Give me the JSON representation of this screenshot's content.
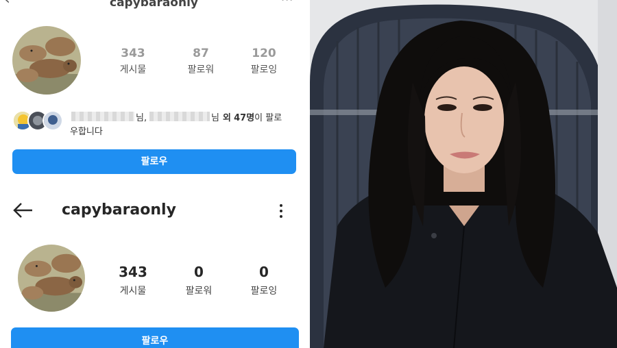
{
  "screenshot_top": {
    "username": "capybaraonly",
    "stats": [
      {
        "value": "343",
        "label": "게시물"
      },
      {
        "value": "87",
        "label": "팔로워"
      },
      {
        "value": "120",
        "label": "팔로잉"
      }
    ],
    "followed_by": {
      "suffix_1": "님,",
      "suffix_2": "님",
      "others_prefix": "외",
      "others_count": "47명",
      "tail_1": "이 팔로",
      "tail_2": "우합니다"
    },
    "follow_label": "팔로우"
  },
  "screenshot_bottom": {
    "username": "capybaraonly",
    "stats": [
      {
        "value": "343",
        "label": "게시물"
      },
      {
        "value": "0",
        "label": "팔로워"
      },
      {
        "value": "0",
        "label": "팔로잉"
      }
    ],
    "follow_label": "팔로우"
  },
  "colors": {
    "accent_button": "#1f8ff2",
    "text_dark": "#262626",
    "stat_faded": "#9a9a9a"
  },
  "icons": [
    "back-arrow-icon",
    "more-dots-icon",
    "avatar-capybara"
  ]
}
